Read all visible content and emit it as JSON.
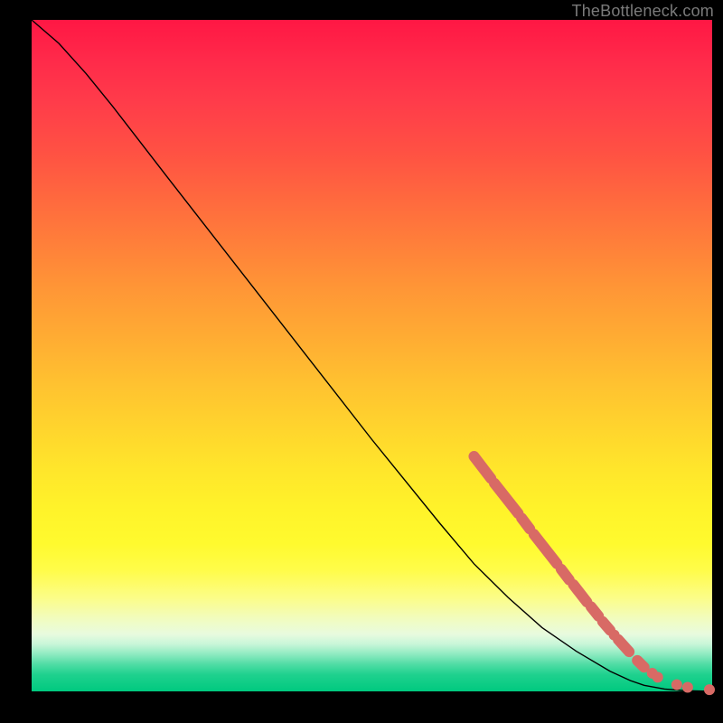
{
  "attribution": "TheBottleneck.com",
  "colors": {
    "bead": "#d86a65",
    "line": "#000000",
    "frame": "#000000"
  },
  "chart_data": {
    "type": "line",
    "title": "",
    "xlabel": "",
    "ylabel": "",
    "x_range": [
      0,
      100
    ],
    "y_range": [
      0,
      100
    ],
    "curve": [
      {
        "x": 0,
        "y": 100.0
      },
      {
        "x": 4,
        "y": 96.5
      },
      {
        "x": 8,
        "y": 92.0
      },
      {
        "x": 12,
        "y": 87.0
      },
      {
        "x": 20,
        "y": 76.5
      },
      {
        "x": 30,
        "y": 63.5
      },
      {
        "x": 40,
        "y": 50.5
      },
      {
        "x": 50,
        "y": 37.5
      },
      {
        "x": 60,
        "y": 25.0
      },
      {
        "x": 65,
        "y": 19.0
      },
      {
        "x": 70,
        "y": 14.0
      },
      {
        "x": 75,
        "y": 9.5
      },
      {
        "x": 80,
        "y": 6.0
      },
      {
        "x": 85,
        "y": 3.0
      },
      {
        "x": 88,
        "y": 1.6
      },
      {
        "x": 90,
        "y": 0.9
      },
      {
        "x": 93,
        "y": 0.35
      },
      {
        "x": 96,
        "y": 0.1
      },
      {
        "x": 100,
        "y": 0.0
      }
    ],
    "bead_segments": [
      {
        "x0": 65.0,
        "y0": 35.0,
        "x1": 67.5,
        "y1": 31.7
      },
      {
        "x0": 68.0,
        "y0": 31.0,
        "x1": 71.5,
        "y1": 26.5
      },
      {
        "x0": 72.0,
        "y0": 25.8,
        "x1": 73.2,
        "y1": 24.2
      },
      {
        "x0": 73.8,
        "y0": 23.4,
        "x1": 77.2,
        "y1": 19.0
      },
      {
        "x0": 77.8,
        "y0": 18.2,
        "x1": 79.0,
        "y1": 16.6
      },
      {
        "x0": 79.6,
        "y0": 15.9,
        "x1": 81.6,
        "y1": 13.3
      },
      {
        "x0": 82.2,
        "y0": 12.6,
        "x1": 83.3,
        "y1": 11.2
      },
      {
        "x0": 83.9,
        "y0": 10.4,
        "x1": 85.0,
        "y1": 9.1
      },
      {
        "x0": 86.2,
        "y0": 7.7,
        "x1": 87.8,
        "y1": 5.9
      },
      {
        "x0": 89.0,
        "y0": 4.6,
        "x1": 90.0,
        "y1": 3.6
      }
    ],
    "bead_dots": [
      {
        "x": 85.6,
        "y": 8.4
      },
      {
        "x": 91.2,
        "y": 2.7
      },
      {
        "x": 92.0,
        "y": 2.1
      },
      {
        "x": 94.8,
        "y": 1.0
      },
      {
        "x": 96.4,
        "y": 0.6
      },
      {
        "x": 99.6,
        "y": 0.25
      }
    ]
  }
}
